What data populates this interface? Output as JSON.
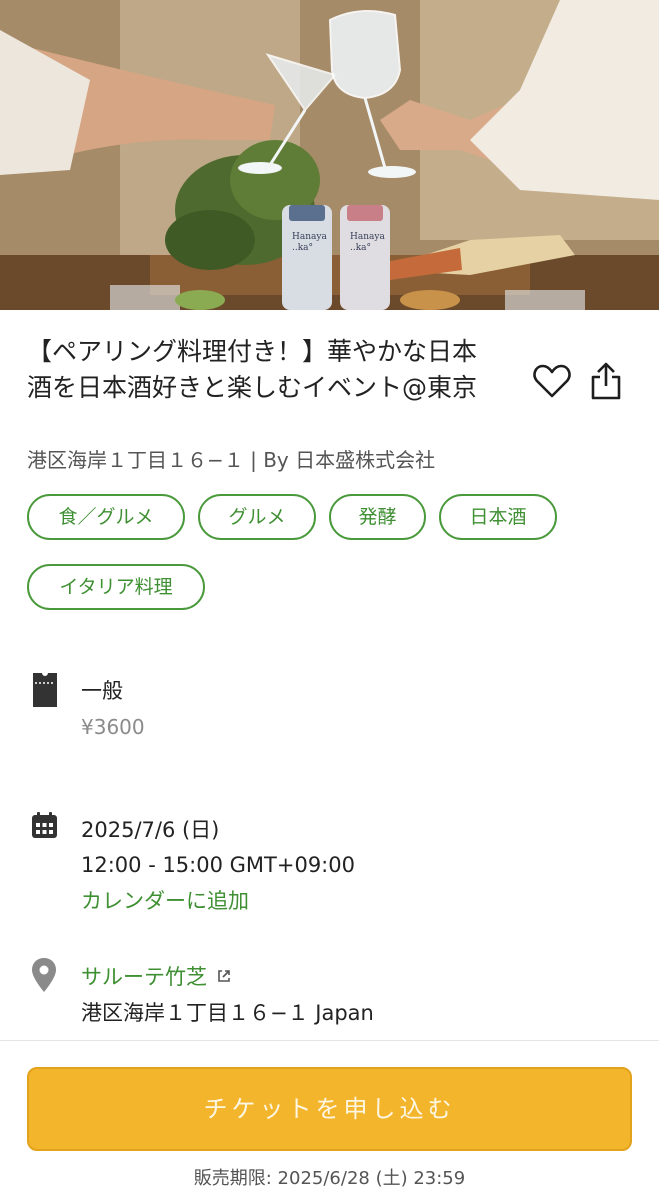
{
  "hero": {
    "bottle_left_brand": "Hanaya\n..ka°",
    "bottle_right_brand": "Hanaya\n..ka°"
  },
  "event": {
    "title": "【ペアリング料理付き！】華やかな日本酒を日本酒好きと楽しむイベント@東京",
    "subtitle": "港区海岸１丁目１６−１ | By 日本盛株式会社",
    "tags": [
      "食／グルメ",
      "グルメ",
      "発酵",
      "日本酒",
      "イタリア料理"
    ]
  },
  "ticket": {
    "icon": "ticket-icon",
    "name": "一般",
    "price": "¥3600"
  },
  "datetime": {
    "icon": "calendar-icon",
    "date": "2025/7/6 (日)",
    "time": "12:00 - 15:00 GMT+09:00",
    "calendar_link": "カレンダーに追加"
  },
  "location": {
    "icon": "map-pin-icon",
    "venue": "サルーテ竹芝",
    "address": "港区海岸１丁目１６−１ Japan"
  },
  "footer": {
    "cta_label": "チケットを申し込む",
    "deadline": "販売期限: 2025/6/28 (土) 23:59"
  },
  "colors": {
    "accent_green": "#3f8f33",
    "cta_yellow": "#f3b52b"
  }
}
